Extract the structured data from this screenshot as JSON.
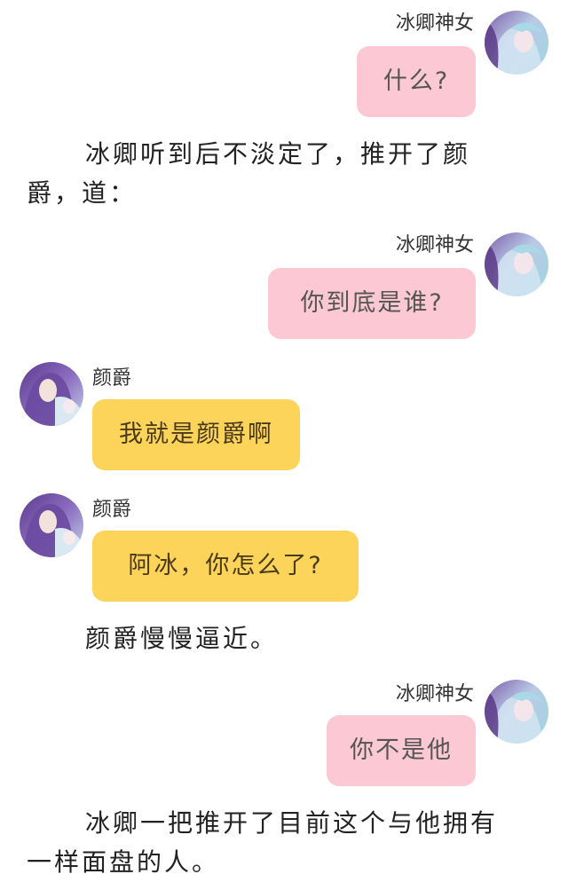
{
  "speakers": {
    "bingqing": "冰卿神女",
    "yanjue": "颜爵"
  },
  "messages": [
    {
      "speaker": "冰卿神女",
      "text": "什么?"
    },
    {
      "speaker": "冰卿神女",
      "text": "你到底是谁?"
    },
    {
      "speaker": "颜爵",
      "text": "我就是颜爵啊"
    },
    {
      "speaker": "颜爵",
      "text": "阿冰，你怎么了?"
    },
    {
      "speaker": "冰卿神女",
      "text": "你不是他"
    }
  ],
  "narrations": [
    {
      "line1": "冰卿听到后不淡定了，推开了颜",
      "line2": "爵，道："
    },
    {
      "line1": "颜爵慢慢逼近。"
    },
    {
      "line1": "冰卿一把推开了目前这个与他拥有",
      "line2": "一样面盘的人。"
    }
  ],
  "colors": {
    "pink_bubble": "#fbc8d4",
    "yellow_bubble": "#fcd45a"
  }
}
